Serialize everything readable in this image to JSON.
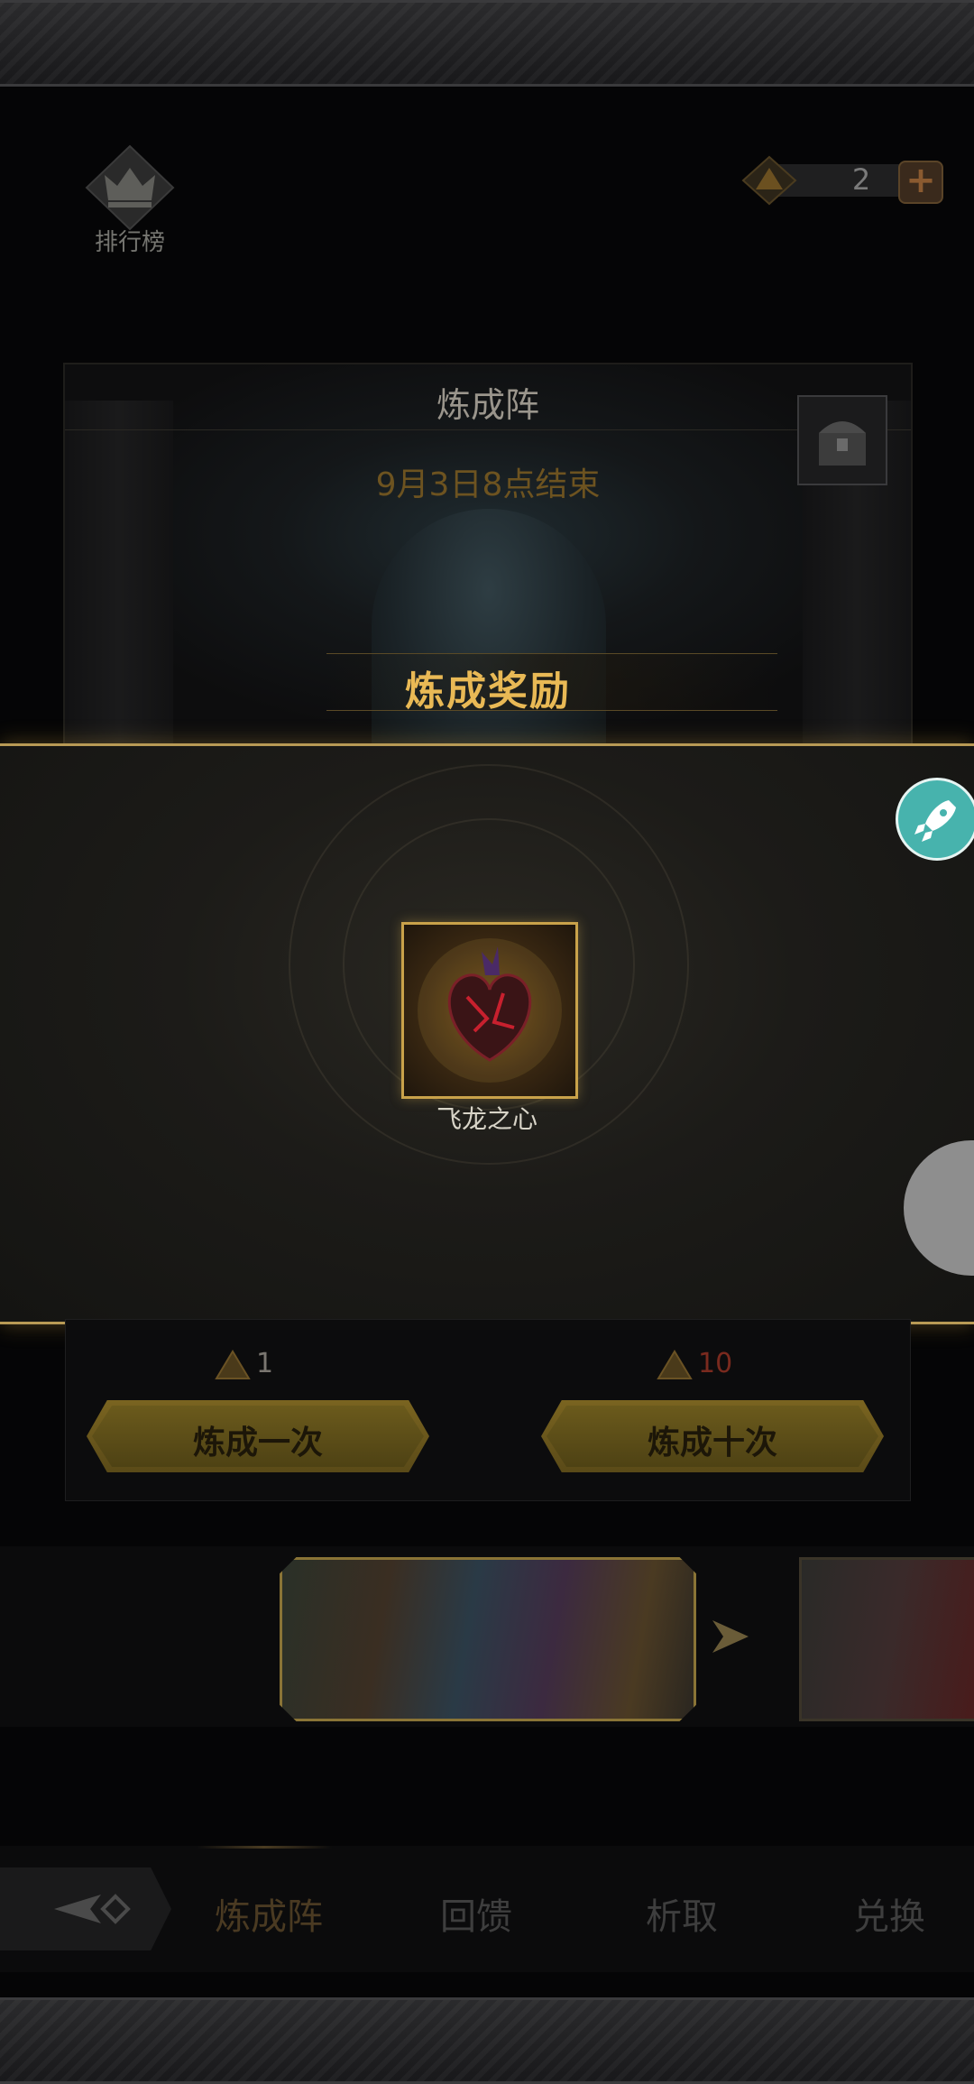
{
  "header": {
    "ranking_label": "排行榜",
    "currency_count": "2",
    "add_icon": "plus-icon",
    "ranking_icon": "crown-icon",
    "currency_icon": "pyramid-gem-icon"
  },
  "event": {
    "title": "炼成阵",
    "end_time": "9月3日8点结束",
    "chest_icon": "treasure-chest-icon"
  },
  "reward": {
    "title": "炼成奖励",
    "item_name": "飞龙之心",
    "item_icon": "dragon-heart-icon"
  },
  "craft": {
    "once": {
      "cost": "1",
      "label": "炼成一次"
    },
    "ten": {
      "cost": "10",
      "label": "炼成十次"
    },
    "cost_icon": "pyramid-gem-icon"
  },
  "floating": {
    "rocket_icon": "rocket-icon"
  },
  "nav": {
    "tabs": [
      "炼成阵",
      "回馈",
      "析取",
      "兑换"
    ],
    "active_index": 0,
    "back_icon": "back-arrow-icon"
  },
  "colors": {
    "gold": "#e9b955",
    "frame_gold": "#b89a55",
    "cost_red": "#7a2a1e",
    "rocket": "#47b3ad"
  }
}
